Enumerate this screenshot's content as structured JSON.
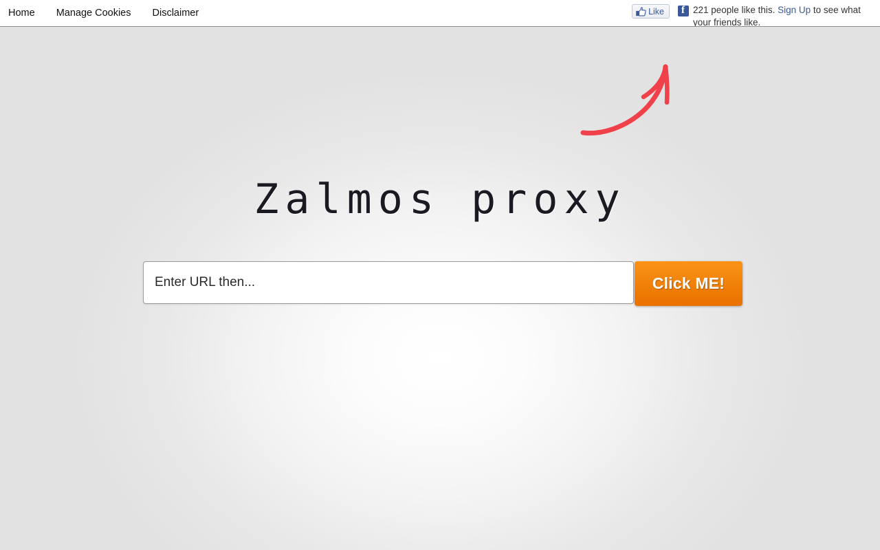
{
  "nav": {
    "items": [
      {
        "label": "Home"
      },
      {
        "label": "Manage Cookies"
      },
      {
        "label": "Disclaimer"
      }
    ]
  },
  "facebook": {
    "like_label": "Like",
    "thumb_icon": "thumbs-up-icon",
    "badge_icon": "facebook-f-icon",
    "social_text_prefix": "221 people like this. ",
    "signup_link": "Sign Up",
    "social_text_suffix": " to see what your friends like.",
    "like_count": 221,
    "brand_color": "#3b5998"
  },
  "annotation": {
    "arrow_icon": "curved-arrow-icon",
    "arrow_color": "#f0404a"
  },
  "hero": {
    "title": "Zalmos proxy"
  },
  "search": {
    "placeholder": "Enter URL then...",
    "value": "",
    "button_label": "Click ME!",
    "button_color": "#ef7d06"
  },
  "page": {
    "background_color": "#e3e3e3",
    "topbar_background": "#ffffff"
  }
}
